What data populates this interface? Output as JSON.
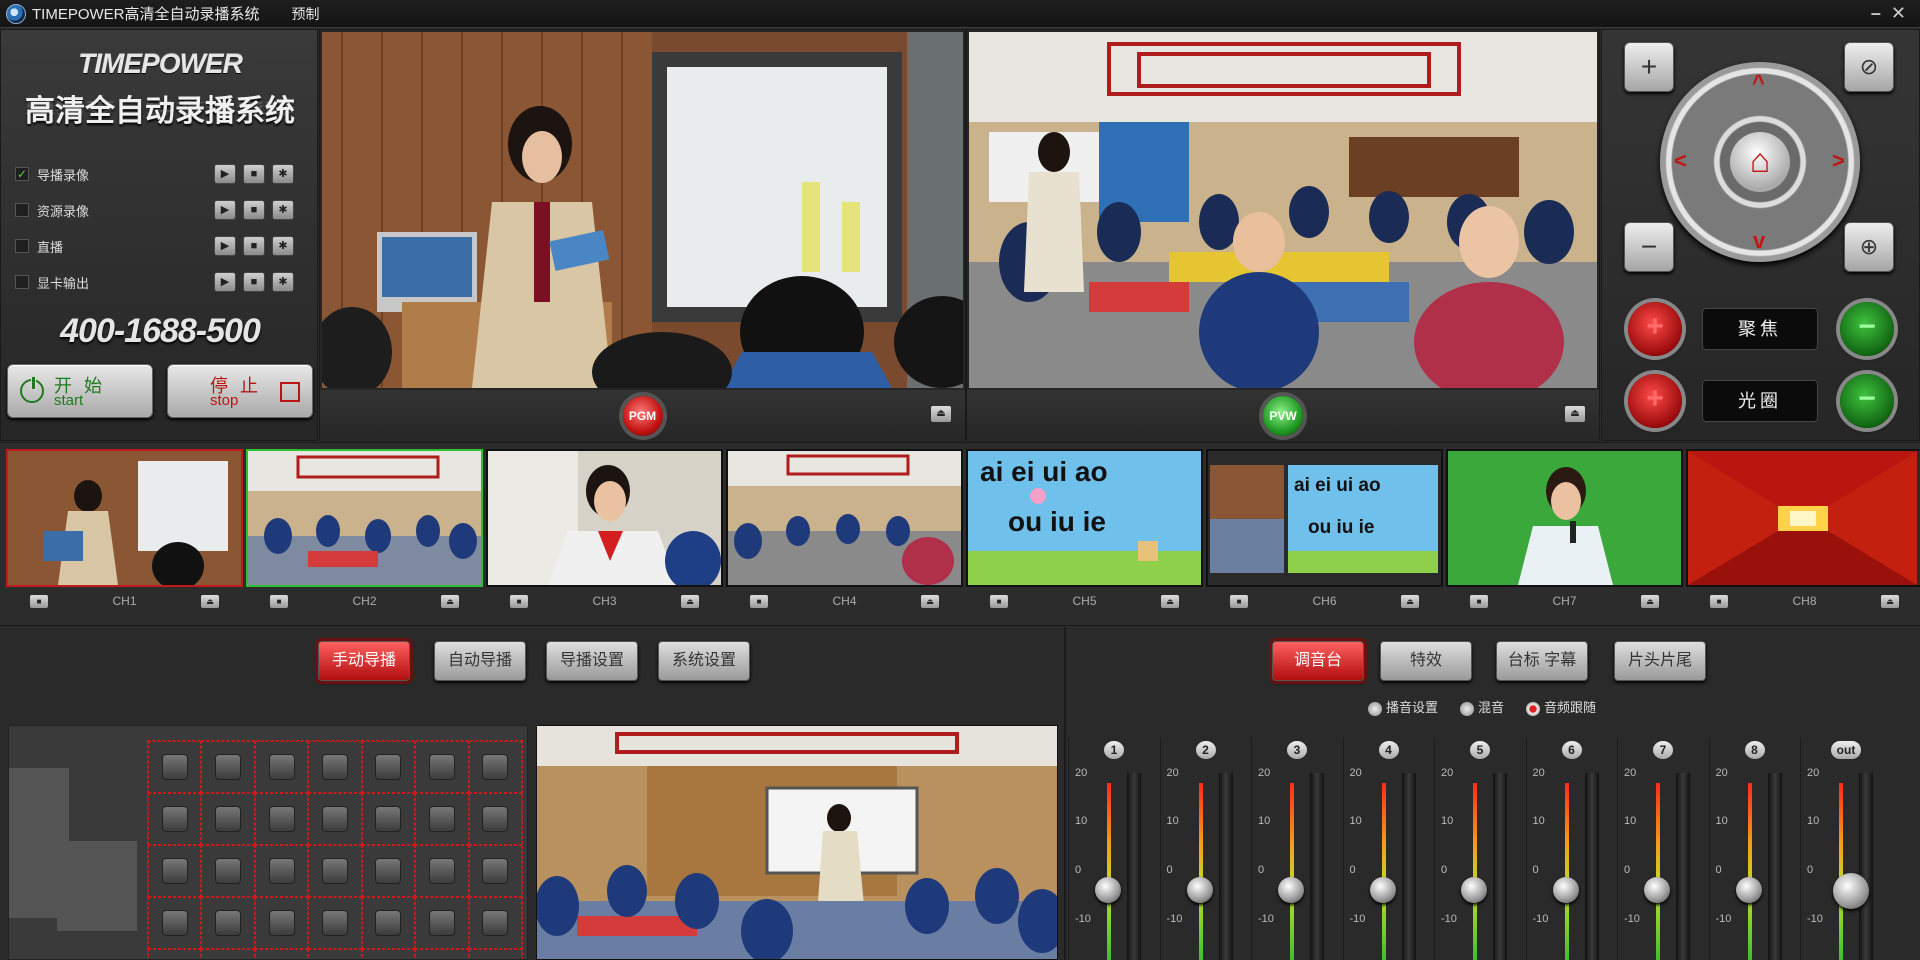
{
  "window": {
    "title": "TIMEPOWER高清全自动录播系统",
    "menu": "预制",
    "minimize": "–",
    "close": "✕"
  },
  "left_panel": {
    "brand": "TIMEPOWER",
    "product": "高清全自动录播系统",
    "rows": [
      {
        "label": "导播录像",
        "checked": true
      },
      {
        "label": "资源录像",
        "checked": false
      },
      {
        "label": "直播",
        "checked": false
      },
      {
        "label": "显卡输出",
        "checked": false
      }
    ],
    "icons": {
      "play": "▶",
      "stop": "■",
      "settings": "✱"
    },
    "hotline": "400-1688-500",
    "start": {
      "zh": "开始",
      "en": "start"
    },
    "stop": {
      "zh": "停止",
      "en": "stop"
    }
  },
  "monitors": {
    "pgm_label": "PGM",
    "pvw_label": "PVW",
    "eject": "⏏"
  },
  "ptz": {
    "zoom_in": "+",
    "zoom_out": "−",
    "focus_label": "聚焦",
    "iris_label": "光圈",
    "plus": "+",
    "minus": "−",
    "home": "⌂",
    "up": "^",
    "down": "v",
    "left": "<",
    "right": ">",
    "tele_icon": "⊘",
    "wide_icon": "⊕"
  },
  "channels": [
    {
      "name": "CH1",
      "state": "pgm"
    },
    {
      "name": "CH2",
      "state": "pvw"
    },
    {
      "name": "CH3",
      "state": ""
    },
    {
      "name": "CH4",
      "state": ""
    },
    {
      "name": "CH5",
      "state": "",
      "text_line1": "ai ei ui ao",
      "text_line2": "ou iu ie"
    },
    {
      "name": "CH6",
      "state": "",
      "text_line1": "ai ei ui ao",
      "text_line2": "ou iu ie"
    },
    {
      "name": "CH7",
      "state": ""
    },
    {
      "name": "CH8",
      "state": ""
    }
  ],
  "director_tabs": [
    "手动导播",
    "自动导播",
    "导播设置",
    "系统设置"
  ],
  "mixer": {
    "tabs": [
      "调音台",
      "特效",
      "台标 字幕",
      "片头片尾"
    ],
    "options": [
      "播音设置",
      "混音",
      "音频跟随"
    ],
    "columns": [
      "1",
      "2",
      "3",
      "4",
      "5",
      "6",
      "7",
      "8",
      "out"
    ],
    "scale": [
      "20",
      "10",
      "0",
      "-10"
    ]
  },
  "colors": {
    "accent_red": "#c41212",
    "accent_green": "#1f9a22",
    "background": "#2b2b2b"
  }
}
